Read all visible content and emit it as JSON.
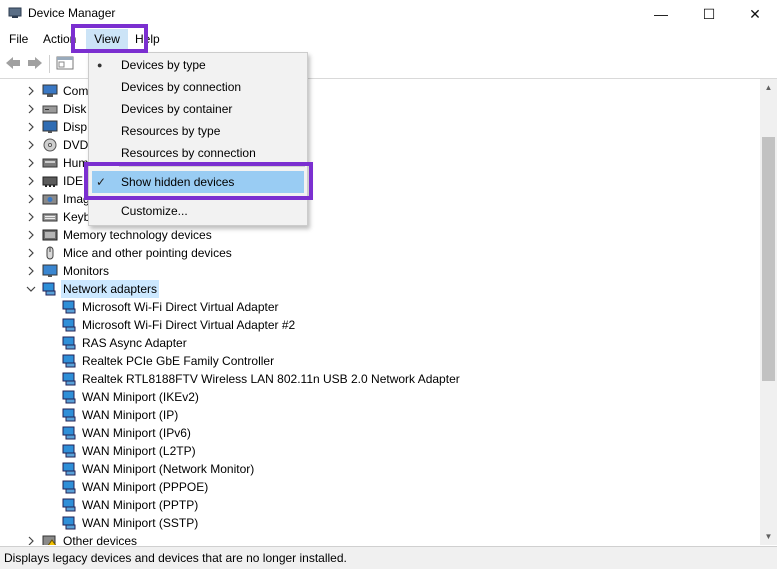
{
  "window": {
    "title": "Device Manager",
    "minimize_glyph": "—",
    "maximize_glyph": "☐",
    "close_glyph": "✕"
  },
  "menu": {
    "file": "File",
    "action": "Action",
    "view": "View",
    "help": "Help"
  },
  "view_menu": {
    "items": [
      {
        "label": "Devices by type",
        "mark": "●"
      },
      {
        "label": "Devices by connection",
        "mark": ""
      },
      {
        "label": "Devices by container",
        "mark": ""
      },
      {
        "label": "Resources by type",
        "mark": ""
      },
      {
        "label": "Resources by connection",
        "mark": ""
      },
      {
        "label": "Show hidden devices",
        "mark": "✓"
      },
      {
        "label": "Customize...",
        "mark": ""
      }
    ]
  },
  "tree": {
    "categories_partial": [
      "Com",
      "Disk",
      "Disp",
      "DVD",
      "Hum",
      "IDE A",
      "Imag",
      "Keyb"
    ],
    "categories": [
      "Memory technology devices",
      "Mice and other pointing devices",
      "Monitors"
    ],
    "network_adapters": "Network adapters",
    "adapters": [
      "Microsoft Wi-Fi Direct Virtual Adapter",
      "Microsoft Wi-Fi Direct Virtual Adapter #2",
      "RAS Async Adapter",
      "Realtek PCIe GbE Family Controller",
      "Realtek RTL8188FTV Wireless LAN 802.11n USB 2.0 Network Adapter",
      "WAN Miniport (IKEv2)",
      "WAN Miniport (IP)",
      "WAN Miniport (IPv6)",
      "WAN Miniport (L2TP)",
      "WAN Miniport (Network Monitor)",
      "WAN Miniport (PPPOE)",
      "WAN Miniport (PPTP)",
      "WAN Miniport (SSTP)"
    ],
    "other_devices": "Other devices"
  },
  "status": {
    "text": "Displays legacy devices and devices that are no longer installed."
  },
  "colors": {
    "highlight_box": "#7b2fd0",
    "selected_item": "#99ccf3",
    "network_row_bg": "#cce8ff"
  }
}
